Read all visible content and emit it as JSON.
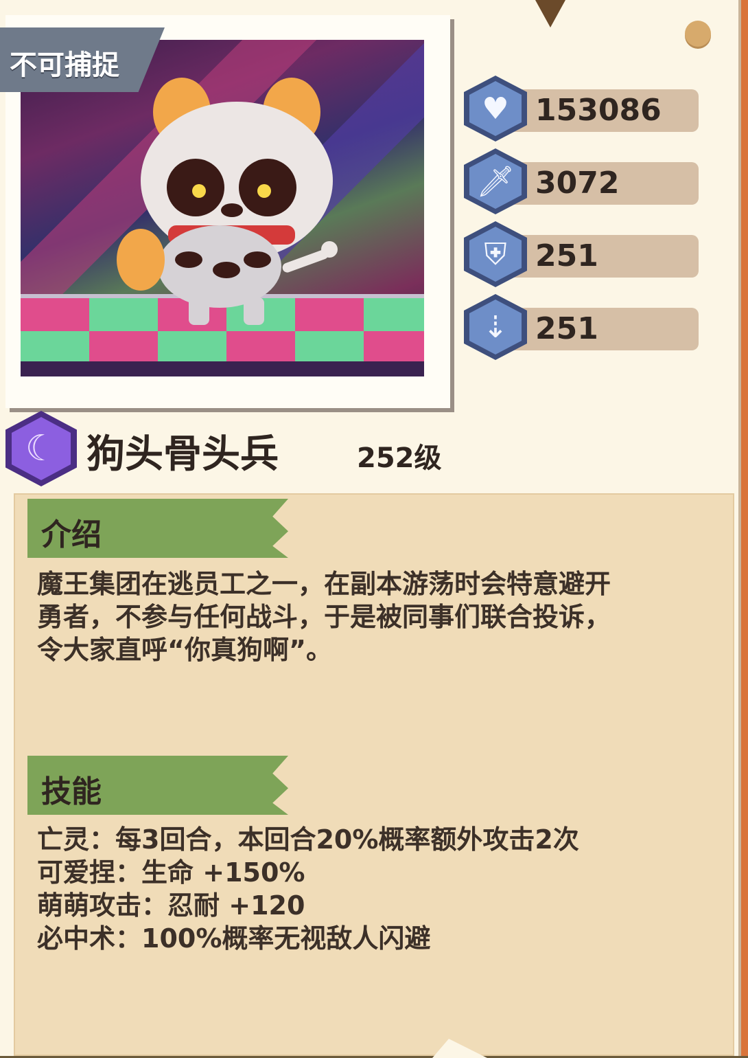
{
  "capture_tag": "不可捕捉",
  "stats": [
    {
      "icon": "heart-icon",
      "value": "153086"
    },
    {
      "icon": "sword-icon",
      "value": "3072"
    },
    {
      "icon": "shield-icon",
      "value": "251"
    },
    {
      "icon": "dodge-icon",
      "value": "251"
    }
  ],
  "monster": {
    "name": "狗头骨头兵",
    "level": "252级",
    "element_icon": "moon-icon"
  },
  "intro": {
    "heading": "介绍",
    "lines": [
      "魔王集团在逃员工之一，在副本游荡时会特意避开",
      "勇者，不参与任何战斗，于是被同事们联合投诉，",
      "令大家直呼“你真狗啊”。"
    ]
  },
  "skills": {
    "heading": "技能",
    "items": [
      "亡灵：每3回合，本回合20%概率额外攻击2次",
      "可爱捏：生命 +150%",
      "萌萌攻击：忍耐 +120",
      "必中术：100%概率无视敌人闪避"
    ]
  },
  "colors": {
    "card_bg": "#fcf6e6",
    "panel_bg": "#f0dcb8",
    "ribbon": "#7ea458",
    "stat_hex": "#6e8ec8",
    "element_hex": "#8c5fe0"
  }
}
